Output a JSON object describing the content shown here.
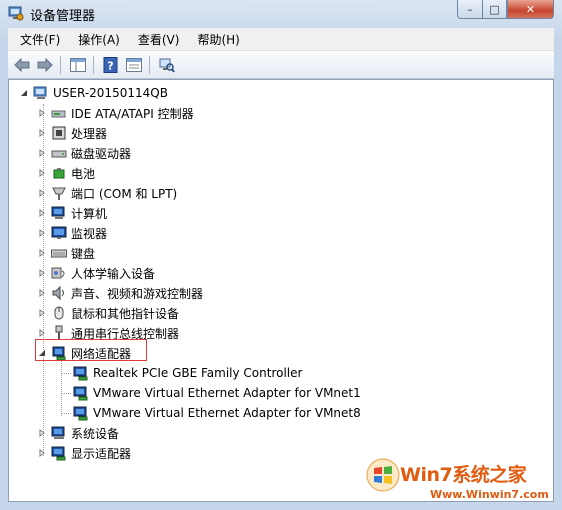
{
  "window": {
    "title": "设备管理器"
  },
  "controls": {
    "minimize": "–",
    "maximize": "□",
    "close": "✕"
  },
  "menu": [
    "文件(F)",
    "操作(A)",
    "查看(V)",
    "帮助(H)"
  ],
  "tree": {
    "root": "USER-20150114QB",
    "items": [
      "IDE ATA/ATAPI 控制器",
      "处理器",
      "磁盘驱动器",
      "电池",
      "端口 (COM 和 LPT)",
      "计算机",
      "监视器",
      "键盘",
      "人体学输入设备",
      "声音、视频和游戏控制器",
      "鼠标和其他指针设备",
      "通用串行总线控制器",
      "网络适配器",
      "系统设备",
      "显示适配器"
    ],
    "network_children": [
      "Realtek PCIe GBE Family Controller",
      "VMware Virtual Ethernet Adapter for VMnet1",
      "VMware Virtual Ethernet Adapter for VMnet8"
    ]
  },
  "watermark": {
    "title": "Win7系统之家",
    "url": "Www.Winwin7.com"
  },
  "colors": {
    "highlight_border": "#e03b3b",
    "watermark": "#e05c10"
  }
}
